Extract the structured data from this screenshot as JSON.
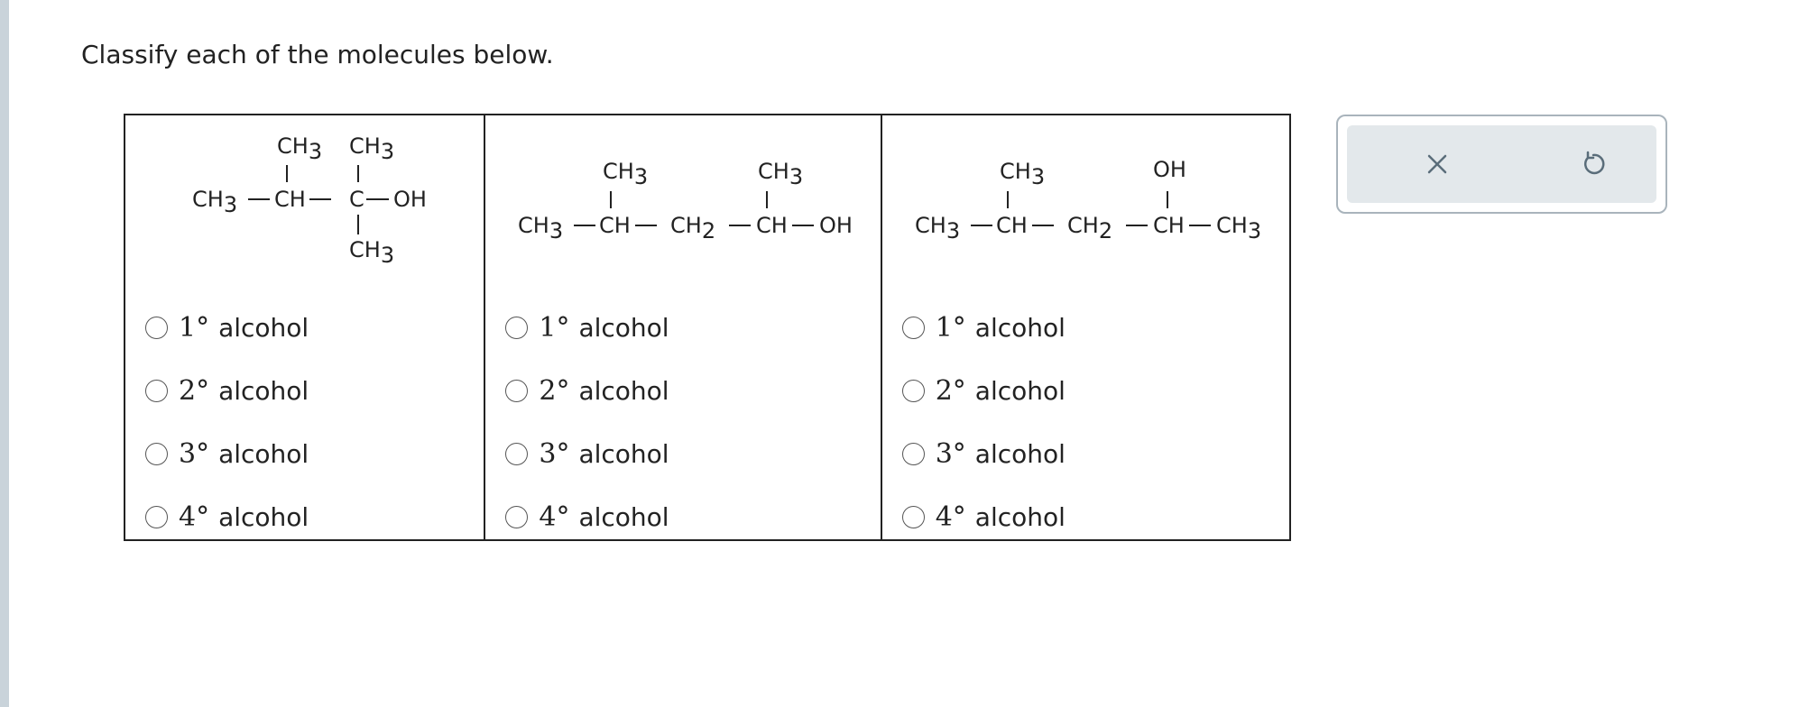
{
  "instruction": "Classify each of the molecules below.",
  "molecules": [
    {
      "top_left_group": "CH3",
      "top_right_group": "CH3",
      "chain_left": "CH3",
      "chain_ch": "CH",
      "chain_c": "C",
      "chain_oh": "OH",
      "bottom_group": "CH3"
    },
    {
      "top_left_group": "CH3",
      "top_right_group": "CH3",
      "chain_left": "CH3",
      "chain_ch_1": "CH",
      "chain_ch2": "CH2",
      "chain_ch_2": "CH",
      "chain_oh": "OH"
    },
    {
      "top_left_group": "CH3",
      "top_right_group": "OH",
      "chain_left": "CH3",
      "chain_ch_1": "CH",
      "chain_ch2": "CH2",
      "chain_ch_2": "CH",
      "chain_right": "CH3"
    }
  ],
  "options": [
    {
      "degree": "1°",
      "word": "alcohol"
    },
    {
      "degree": "2°",
      "word": "alcohol"
    },
    {
      "degree": "3°",
      "word": "alcohol"
    },
    {
      "degree": "4°",
      "word": "alcohol"
    }
  ],
  "toolbar": {
    "close_icon": "close-icon",
    "reset_icon": "undo-icon"
  },
  "colors": {
    "text": "#222222",
    "toolbar_bg": "#e3e8eb",
    "toolbar_border": "#a9b4bc",
    "icon": "#5a6d7a",
    "left_strip": "#c9d3da"
  }
}
